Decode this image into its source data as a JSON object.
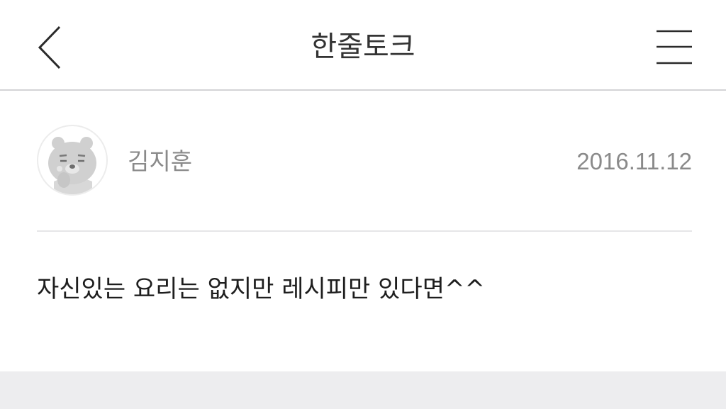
{
  "header": {
    "title": "한줄토크",
    "back_icon": "chevron-left-icon",
    "menu_icon": "hamburger-menu-icon"
  },
  "post": {
    "author": "김지훈",
    "date": "2016.11.12",
    "avatar_icon": "character-avatar-icon",
    "content": "자신있는 요리는 없지만 레시피만 있다면^^"
  },
  "colors": {
    "header_border": "#d4d4d6",
    "meta_text": "#8a8a8a",
    "body_text": "#1e1e1e",
    "bottom_band": "#ededef"
  }
}
